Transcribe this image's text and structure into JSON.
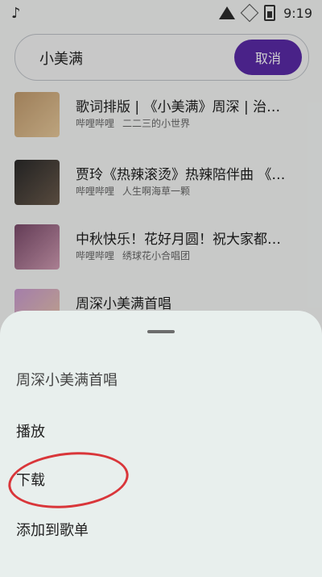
{
  "status": {
    "time": "9:19"
  },
  "search": {
    "query": "小美满",
    "cancel_label": "取消"
  },
  "results": [
    {
      "title": "歌词排版 | 《小美满》周深 | 治…",
      "source": "哔哩哔哩",
      "author": "二二三的小世界"
    },
    {
      "title": "贾玲《热辣滚烫》热辣陪伴曲 《…",
      "source": "哔哩哔哩",
      "author": "人生啊海草一颗"
    },
    {
      "title": "中秋快乐！花好月圆！祝大家都…",
      "source": "哔哩哔哩",
      "author": "绣球花小合唱团"
    },
    {
      "title": "周深小美满首唱",
      "source": "",
      "author": ""
    }
  ],
  "sheet": {
    "title": "周深小美满首唱",
    "options": {
      "play": "播放",
      "download": "下载",
      "add_to_playlist": "添加到歌单"
    }
  },
  "colors": {
    "accent": "#5a2aa6",
    "annotation": "#d9363a"
  },
  "icons": {
    "music_note": "♪"
  }
}
